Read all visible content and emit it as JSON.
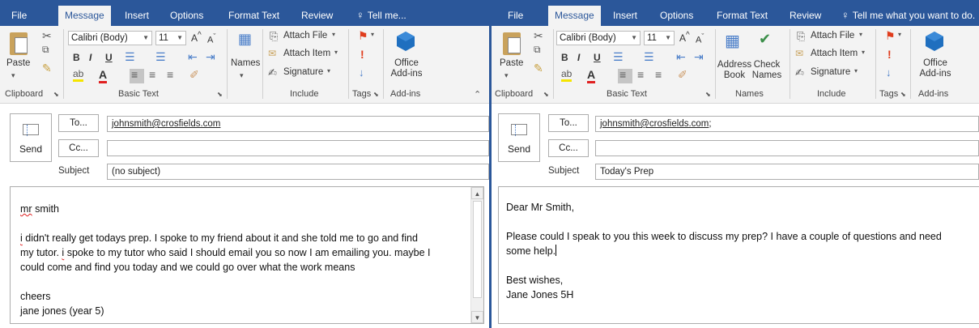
{
  "left": {
    "tabs": [
      "File",
      "Message",
      "Insert",
      "Options",
      "Format Text",
      "Review",
      "Tell me..."
    ],
    "active_tab": "Message",
    "ribbon": {
      "paste_label": "Paste",
      "font_name": "Calibri (Body)",
      "font_size": "11",
      "names_label": "Names",
      "attach_file": "Attach File",
      "attach_item": "Attach Item",
      "signature": "Signature",
      "office_addins_line1": "Office",
      "office_addins_line2": "Add-ins",
      "groups": [
        "Clipboard",
        "Basic Text",
        "Include",
        "Tags",
        "Add-ins"
      ]
    },
    "send_label": "Send",
    "to_label": "To...",
    "cc_label": "Cc...",
    "subject_label": "Subject",
    "to_value": "johnsmith@crosfields.com",
    "cc_value": "",
    "subject_value": "(no subject)",
    "body": {
      "greeting_word1": "mr",
      "greeting_word2": "smith",
      "p1_l1_w": "i",
      "p1_l1_rest": "didn't really get todays prep. I spoke to my friend about it and she told me to go and find",
      "p1_l2_pre": "my tutor.",
      "p1_l2_w": "i",
      "p1_l2_rest": "spoke to my tutor who said I should email you so now I am emailing you. maybe I",
      "p1_l3": "could come and find you today and we could go over what the work means",
      "closing": "cheers",
      "signoff": "jane jones (year 5)"
    }
  },
  "right": {
    "tabs": [
      "File",
      "Message",
      "Insert",
      "Options",
      "Format Text",
      "Review",
      "Tell me what you want to do."
    ],
    "active_tab": "Message",
    "ribbon": {
      "paste_label": "Paste",
      "font_name": "Calibri (Body)",
      "font_size": "11",
      "address_book_l1": "Address",
      "address_book_l2": "Book",
      "check_names_l1": "Check",
      "check_names_l2": "Names",
      "attach_file": "Attach File",
      "attach_item": "Attach Item",
      "signature": "Signature",
      "office_addins_line1": "Office",
      "office_addins_line2": "Add-ins",
      "groups": [
        "Clipboard",
        "Basic Text",
        "Names",
        "Include",
        "Tags",
        "Add-ins"
      ]
    },
    "send_label": "Send",
    "to_label": "To...",
    "cc_label": "Cc...",
    "subject_label": "Subject",
    "to_value": "johnsmith@crosfields.com",
    "to_suffix": ";",
    "cc_value": "",
    "subject_value": "Today's Prep",
    "body": {
      "greeting": "Dear Mr Smith,",
      "p1_l1": "Please could I speak to you this week to discuss my prep? I have a couple of questions and need",
      "p1_l2": "some help.",
      "closing": "Best wishes,",
      "signoff": "Jane Jones 5H"
    }
  },
  "colors": {
    "accent": "#2b579a",
    "flag": "#e03c1c",
    "office_blue": "#1f6fbf"
  },
  "icons": [
    "paste-icon",
    "cut-icon",
    "copy-icon",
    "format-painter-icon",
    "bullets-icon",
    "numbering-icon",
    "indent-icon",
    "highlight-icon",
    "font-color-icon",
    "align-left-icon",
    "align-center-icon",
    "align-right-icon",
    "clear-format-icon",
    "address-book-icon",
    "check-names-icon",
    "attach-file-icon",
    "attach-item-icon",
    "signature-icon",
    "flag-icon",
    "importance-high-icon",
    "importance-low-icon",
    "office-addins-icon",
    "lightbulb-icon",
    "send-icon",
    "collapse-ribbon-icon"
  ]
}
